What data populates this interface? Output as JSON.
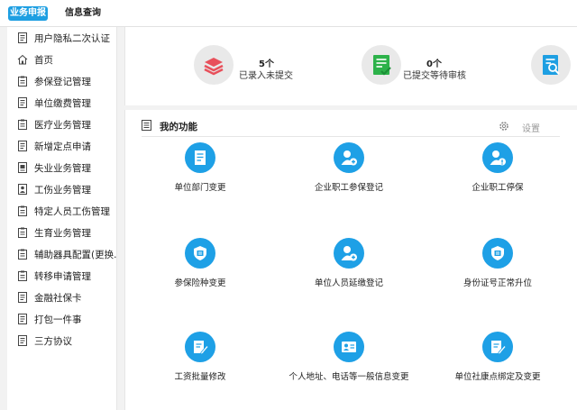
{
  "tabs": [
    {
      "label": "业务申报",
      "active": true
    },
    {
      "label": "信息查询",
      "active": false
    }
  ],
  "sidebar": {
    "items": [
      {
        "label": "用户隐私二次认证",
        "icon": "document-icon"
      },
      {
        "label": "首页",
        "icon": "home-icon"
      },
      {
        "label": "参保登记管理",
        "icon": "clipboard-icon"
      },
      {
        "label": "单位缴费管理",
        "icon": "document-icon"
      },
      {
        "label": "医疗业务管理",
        "icon": "clipboard-icon"
      },
      {
        "label": "新增定点申请",
        "icon": "document-icon"
      },
      {
        "label": "失业业务管理",
        "icon": "image-document-icon"
      },
      {
        "label": "工伤业务管理",
        "icon": "person-card-icon"
      },
      {
        "label": "特定人员工伤管理",
        "icon": "clipboard-icon"
      },
      {
        "label": "生育业务管理",
        "icon": "clipboard-icon"
      },
      {
        "label": "辅助器具配置(更换...",
        "icon": "clipboard-icon"
      },
      {
        "label": "转移申请管理",
        "icon": "clipboard-icon"
      },
      {
        "label": "金融社保卡",
        "icon": "document-icon"
      },
      {
        "label": "打包一件事",
        "icon": "document-icon"
      },
      {
        "label": "三方协议",
        "icon": "document-icon"
      }
    ]
  },
  "stats": [
    {
      "count": "5个",
      "label": "已录入未提交",
      "icon": "stack-icon"
    },
    {
      "count": "0个",
      "label": "已提交等待审核",
      "icon": "checklist-icon"
    },
    {
      "icon": "search-document-icon"
    }
  ],
  "functions": {
    "title": "我的功能",
    "settings_label": "设置",
    "items": [
      {
        "label": "单位部门变更",
        "icon": "document-icon"
      },
      {
        "label": "企业职工参保登记",
        "icon": "add-user-icon"
      },
      {
        "label": "企业职工停保",
        "icon": "user-pause-icon"
      },
      {
        "label": "参保险种变更",
        "icon": "shield-icon"
      },
      {
        "label": "单位人员延缴登记",
        "icon": "add-user-icon"
      },
      {
        "label": "身份证号正常升位",
        "icon": "shield-icon"
      },
      {
        "label": "工资批量修改",
        "icon": "edit-document-icon"
      },
      {
        "label": "个人地址、电话等一般信息变更",
        "icon": "contact-card-icon"
      },
      {
        "label": "单位社康点绑定及变更",
        "icon": "edit-document-icon"
      }
    ]
  },
  "colors": {
    "accent": "#1ea0e6",
    "stat_red": "#e8505b",
    "stat_green": "#2db24a",
    "stat_blue": "#1e9fe2"
  }
}
